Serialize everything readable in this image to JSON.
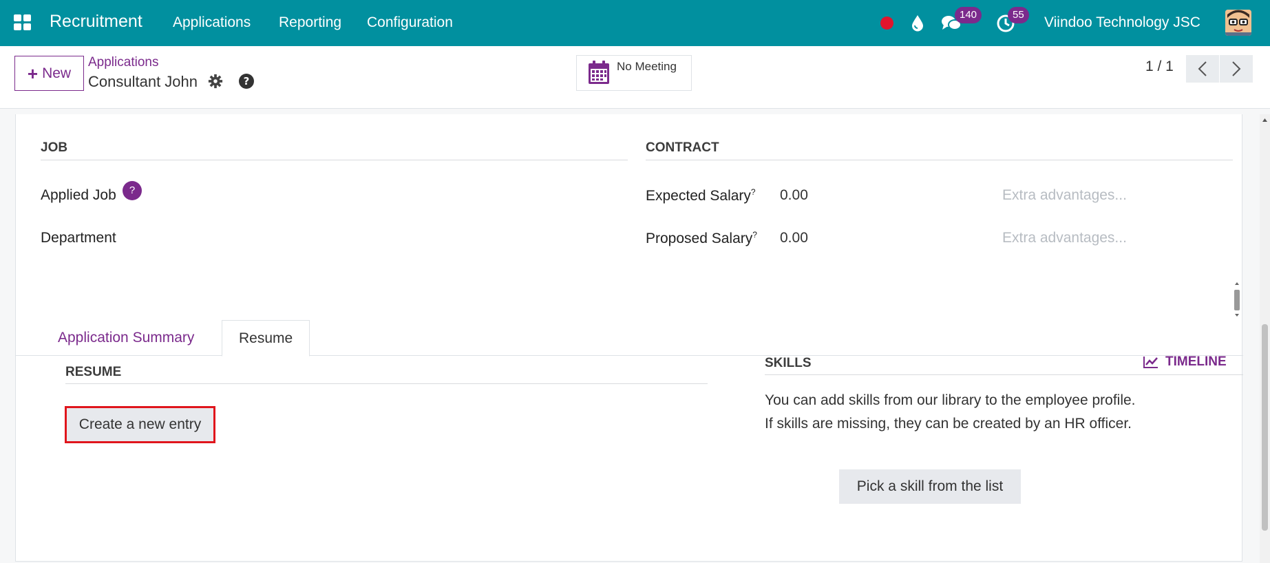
{
  "navbar": {
    "app_name": "Recruitment",
    "menu": [
      "Applications",
      "Reporting",
      "Configuration"
    ],
    "messages_count": "140",
    "activities_count": "55",
    "company": "Viindoo Technology JSC",
    "colors": {
      "bar": "#01909f",
      "badge": "#7b2a8c",
      "record_dot": "#e0152d"
    }
  },
  "control_panel": {
    "new_label": "New",
    "breadcrumb_parent": "Applications",
    "breadcrumb_current": "Consultant John",
    "meeting_label": "No Meeting",
    "pager": "1 / 1"
  },
  "form": {
    "job": {
      "title": "JOB",
      "applied_job_label": "Applied Job",
      "applied_job_help": "?",
      "department_label": "Department"
    },
    "contract": {
      "title": "CONTRACT",
      "expected_salary_label": "Expected Salary",
      "expected_salary_value": "0.00",
      "expected_extra_placeholder": "Extra advantages...",
      "proposed_salary_label": "Proposed Salary",
      "proposed_salary_value": "0.00",
      "proposed_extra_placeholder": "Extra advantages...",
      "help_mark": "?"
    },
    "tabs": [
      {
        "label": "Application Summary",
        "active": false
      },
      {
        "label": "Resume",
        "active": true
      }
    ],
    "resume": {
      "title": "RESUME",
      "create_label": "Create a new entry"
    },
    "skills": {
      "title": "SKILLS",
      "timeline_label": "TIMELINE",
      "line1": "You can add skills from our library to the employee profile.",
      "line2": "If skills are missing, they can be created by an HR officer.",
      "pick_label": "Pick a skill from the list"
    },
    "accent_color": "#7b2a8c",
    "highlight_color": "#e0151c"
  }
}
